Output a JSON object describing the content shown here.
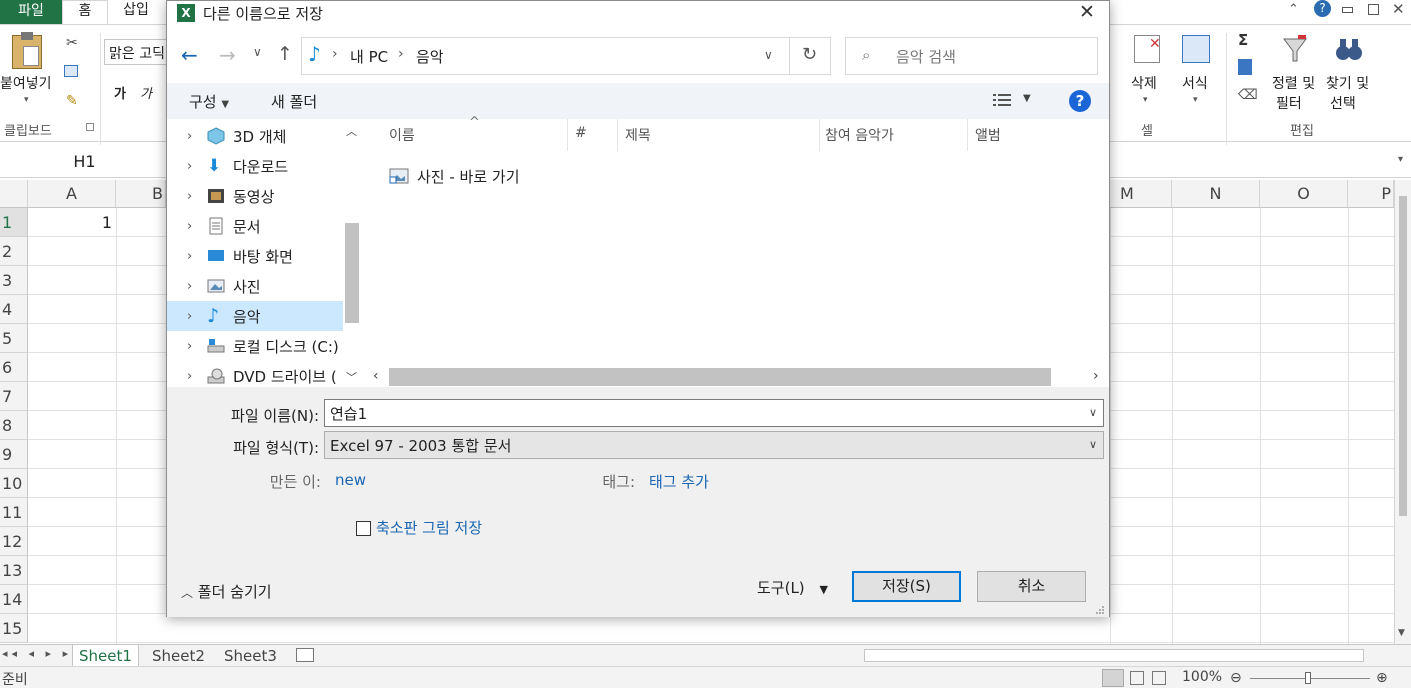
{
  "excel": {
    "tabs": {
      "file": "파일",
      "home": "홈",
      "insert": "삽입"
    },
    "ribbon": {
      "paste": "붙여넣기",
      "font_name": "맑은 고딕",
      "bold": "가",
      "italic": "가",
      "clipboard_group": "클립보드",
      "delete": "삭제",
      "format": "서식",
      "cells_group": "셀",
      "sort_filter_line1": "정렬 및",
      "sort_filter_line2": "필터",
      "find_select_line1": "찾기 및",
      "find_select_line2": "선택",
      "editing_group": "편집",
      "sigma": "Σ"
    },
    "name_box": "H1",
    "columns": [
      "A",
      "B",
      "M",
      "N",
      "O",
      "P"
    ],
    "rows": [
      "1",
      "2",
      "3",
      "4",
      "5",
      "6",
      "7",
      "8",
      "9",
      "10",
      "11",
      "12",
      "13",
      "14",
      "15"
    ],
    "cell_a1": "1",
    "sheets": [
      "Sheet1",
      "Sheet2",
      "Sheet3"
    ],
    "status": "준비",
    "zoom": "100%"
  },
  "dialog": {
    "title": "다른 이름으로 저장",
    "breadcrumb": [
      "내 PC",
      "음악"
    ],
    "search_placeholder": "음악 검색",
    "organize": "구성",
    "new_folder": "새 폴더",
    "help": "?",
    "nav_items": [
      {
        "label": "3D 개체",
        "icon": "3d-objects-icon"
      },
      {
        "label": "다운로드",
        "icon": "download-icon"
      },
      {
        "label": "동영상",
        "icon": "video-icon"
      },
      {
        "label": "문서",
        "icon": "document-icon"
      },
      {
        "label": "바탕 화면",
        "icon": "desktop-icon"
      },
      {
        "label": "사진",
        "icon": "pictures-icon"
      },
      {
        "label": "음악",
        "icon": "music-icon",
        "selected": true
      },
      {
        "label": "로컬 디스크 (C:)",
        "icon": "local-disk-icon"
      },
      {
        "label": "DVD 드라이브 (",
        "icon": "dvd-drive-icon"
      }
    ],
    "columns": [
      "이름",
      "#",
      "제목",
      "참여 음악가",
      "앨범"
    ],
    "files": [
      {
        "name": "사진 - 바로 가기",
        "icon": "shortcut-icon"
      }
    ],
    "filename_label": "파일 이름(N):",
    "filename_value": "연습1",
    "filetype_label": "파일 형식(T):",
    "filetype_value": "Excel 97 - 2003 통합 문서",
    "author_label": "만든 이:",
    "author_value": "new",
    "tags_label": "태그:",
    "tags_value": "태그 추가",
    "thumbnail_label": "축소판 그림 저장",
    "hide_folders": "폴더 숨기기",
    "tools": "도구(L)",
    "save": "저장(S)",
    "cancel": "취소"
  }
}
